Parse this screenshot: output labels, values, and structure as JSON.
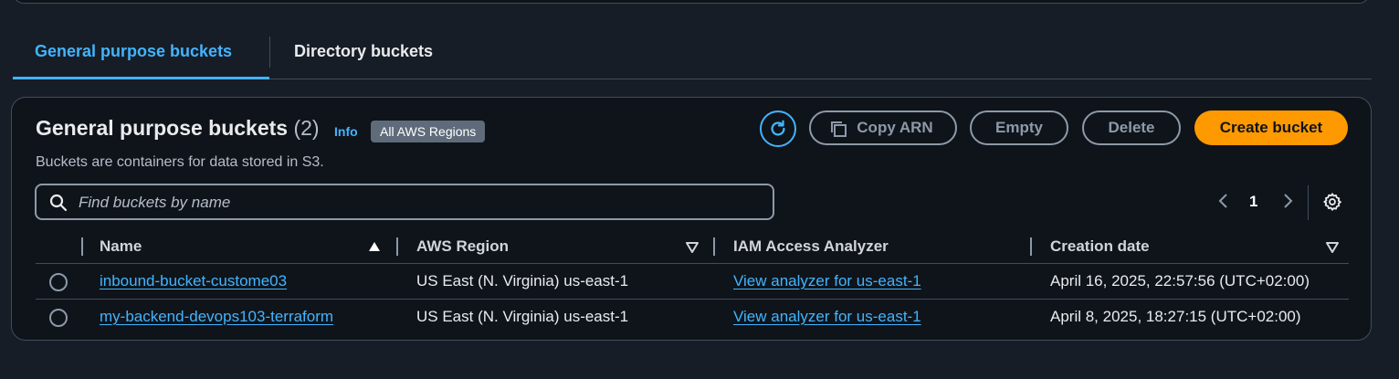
{
  "tabs": [
    {
      "label": "General purpose buckets",
      "active": true
    },
    {
      "label": "Directory buckets",
      "active": false
    }
  ],
  "panel": {
    "title": "General purpose buckets",
    "count": "(2)",
    "info": "Info",
    "regions_badge": "All AWS Regions",
    "description": "Buckets are containers for data stored in S3."
  },
  "actions": {
    "refresh_icon": "refresh-icon",
    "copy_arn": "Copy ARN",
    "empty": "Empty",
    "delete": "Delete",
    "create": "Create bucket"
  },
  "search": {
    "placeholder": "Find buckets by name",
    "value": ""
  },
  "pagination": {
    "current_page": "1"
  },
  "table": {
    "columns": [
      "Name",
      "AWS Region",
      "IAM Access Analyzer",
      "Creation date"
    ],
    "rows": [
      {
        "name": "inbound-bucket-custome03",
        "region": "US East (N. Virginia) us-east-1",
        "analyzer": "View analyzer for us-east-1",
        "created": "April 16, 2025, 22:57:56 (UTC+02:00)"
      },
      {
        "name": "my-backend-devops103-terraform",
        "region": "US East (N. Virginia) us-east-1",
        "analyzer": "View analyzer for us-east-1",
        "created": "April 8, 2025, 18:27:15 (UTC+02:00)"
      }
    ]
  },
  "colors": {
    "accent": "#42b4ff",
    "primary_button": "#ff9900",
    "background": "#161d26",
    "panel": "#0f141a"
  }
}
